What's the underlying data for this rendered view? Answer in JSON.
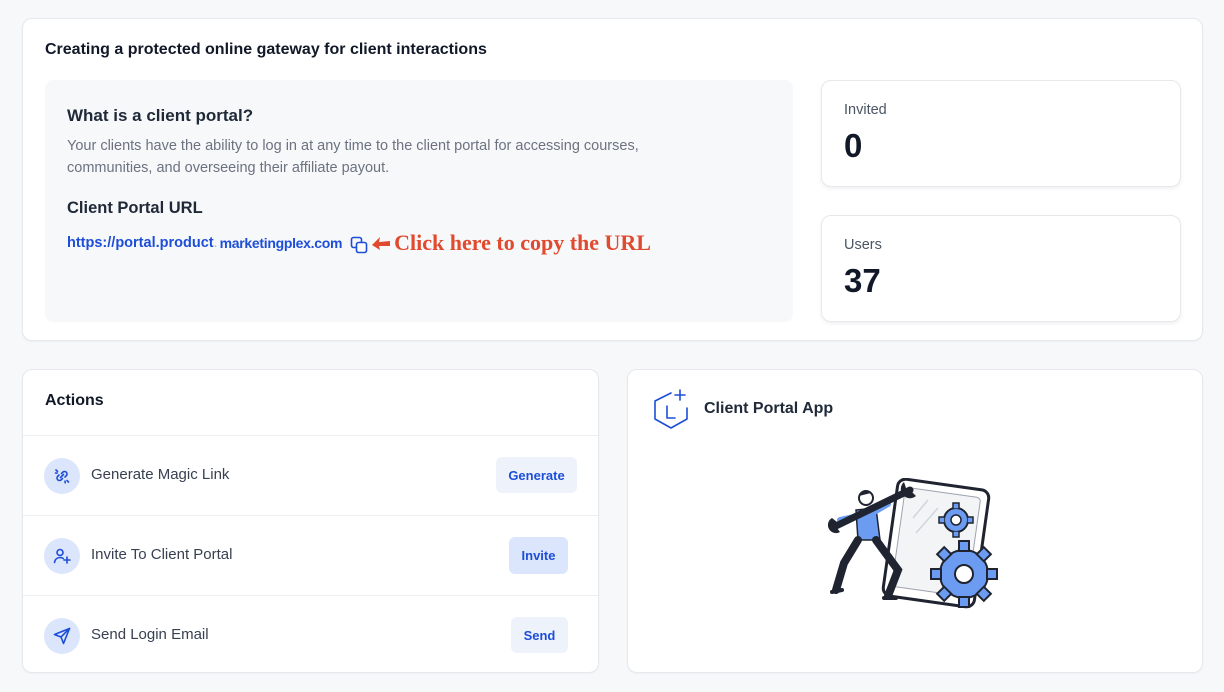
{
  "gateway": {
    "title": "Creating a protected online gateway for client interactions",
    "info": {
      "heading": "What is a client portal?",
      "description": "Your clients have the ability to log in at any time to the client portal for accessing courses, communities, and overseeing their affiliate payout.",
      "url_heading": "Client Portal URL",
      "url_part1": "https://portal.product",
      "url_dot": ".",
      "url_part2": "marketingplex.com",
      "copy_icon": "copy-icon",
      "copy_hint": "Click here to copy the URL"
    },
    "stats": [
      {
        "label": "Invited",
        "value": "0"
      },
      {
        "label": "Users",
        "value": "37"
      }
    ]
  },
  "actions": {
    "title": "Actions",
    "items": [
      {
        "label": "Generate Magic Link",
        "button": "Generate",
        "icon": "magic-link-icon"
      },
      {
        "label": "Invite To Client Portal",
        "button": "Invite",
        "icon": "add-user-icon"
      },
      {
        "label": "Send Login Email",
        "button": "Send",
        "icon": "send-icon"
      }
    ]
  },
  "app": {
    "title": "Client Portal App",
    "icon": "client-portal-app-icon",
    "illustration": "repair-gears-illustration"
  },
  "colors": {
    "accent": "#1d4ed8",
    "icon_bg": "#dbe5fb",
    "hint": "#e04a2f",
    "page_bg": "#f7f8fa"
  }
}
